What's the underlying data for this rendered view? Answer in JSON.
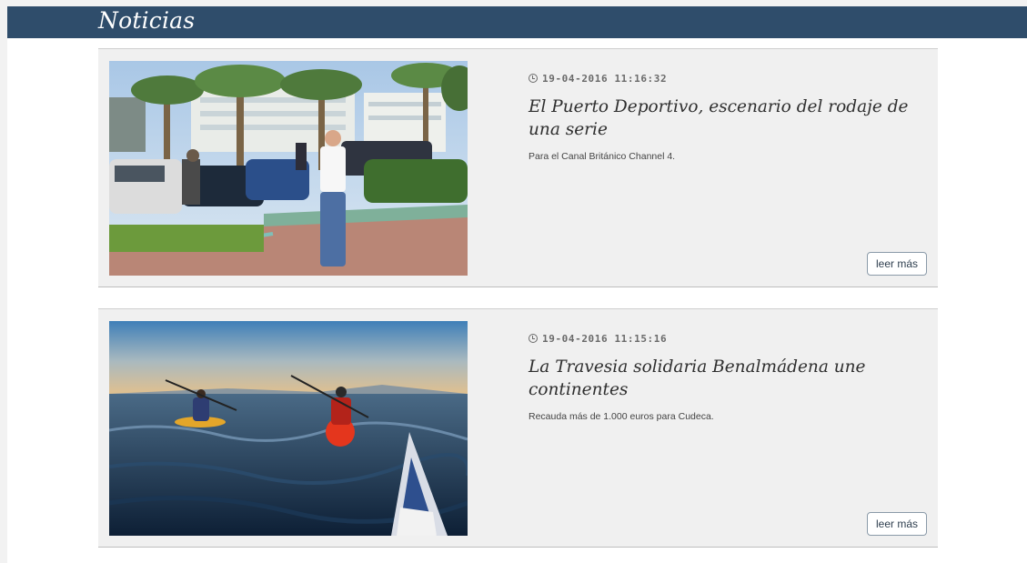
{
  "header": {
    "title": "Noticias"
  },
  "colors": {
    "header_bg": "#2f4d6b",
    "card_bg": "#f0f0f0"
  },
  "news": [
    {
      "date": "19-04-2016 11:16:32",
      "title": "El Puerto Deportivo, escenario del rodaje de una serie",
      "summary": "Para el Canal Británico Channel 4.",
      "read_more": "leer más"
    },
    {
      "date": "19-04-2016 11:15:16",
      "title": "La Travesia solidaria Benalmádena une continentes",
      "summary": "Recauda más de 1.000 euros para Cudeca.",
      "read_more": "leer más"
    }
  ]
}
